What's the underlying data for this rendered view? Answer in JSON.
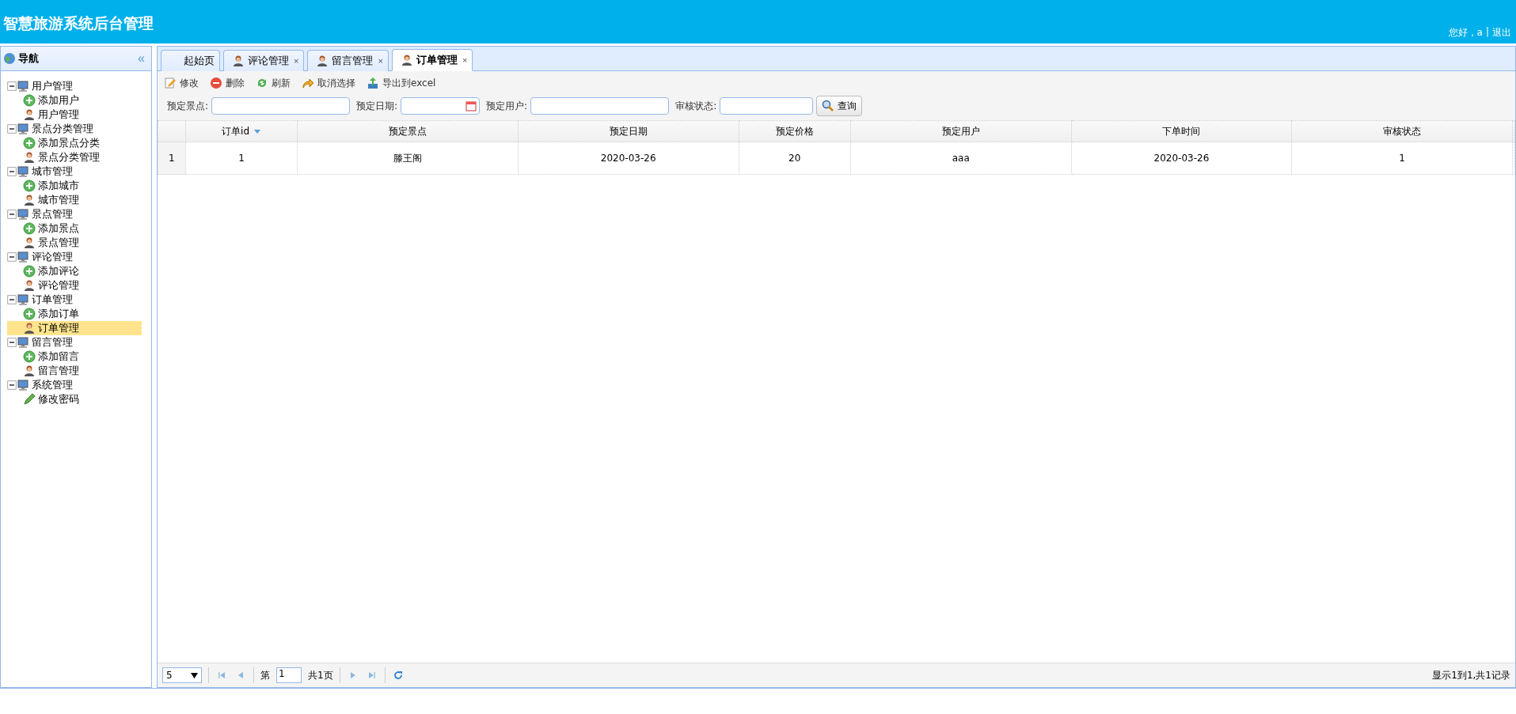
{
  "header": {
    "title": "智慧旅游系统后台管理",
    "greeting": "您好，a",
    "separator": "|",
    "logout": "退出"
  },
  "sidebar": {
    "title": "导航",
    "collapse": "«",
    "tree": [
      {
        "label": "用户管理",
        "children": [
          {
            "label": "添加用户",
            "kind": "add",
            "selected": false
          },
          {
            "label": "用户管理",
            "kind": "user",
            "selected": false
          }
        ]
      },
      {
        "label": "景点分类管理",
        "children": [
          {
            "label": "添加景点分类",
            "kind": "add",
            "selected": false
          },
          {
            "label": "景点分类管理",
            "kind": "user",
            "selected": false
          }
        ]
      },
      {
        "label": "城市管理",
        "children": [
          {
            "label": "添加城市",
            "kind": "add",
            "selected": false
          },
          {
            "label": "城市管理",
            "kind": "user",
            "selected": false
          }
        ]
      },
      {
        "label": "景点管理",
        "children": [
          {
            "label": "添加景点",
            "kind": "add",
            "selected": false
          },
          {
            "label": "景点管理",
            "kind": "user",
            "selected": false
          }
        ]
      },
      {
        "label": "评论管理",
        "children": [
          {
            "label": "添加评论",
            "kind": "add",
            "selected": false
          },
          {
            "label": "评论管理",
            "kind": "user",
            "selected": false
          }
        ]
      },
      {
        "label": "订单管理",
        "children": [
          {
            "label": "添加订单",
            "kind": "add",
            "selected": false
          },
          {
            "label": "订单管理",
            "kind": "user",
            "selected": true
          }
        ]
      },
      {
        "label": "留言管理",
        "children": [
          {
            "label": "添加留言",
            "kind": "add",
            "selected": false
          },
          {
            "label": "留言管理",
            "kind": "user",
            "selected": false
          }
        ]
      },
      {
        "label": "系统管理",
        "children": [
          {
            "label": "修改密码",
            "kind": "edit",
            "selected": false
          }
        ]
      }
    ]
  },
  "tabs": [
    {
      "label": "起始页",
      "kind": "plain",
      "selected": false
    },
    {
      "label": "评论管理",
      "kind": "user",
      "close": "×",
      "selected": false
    },
    {
      "label": "留言管理",
      "kind": "user",
      "close": "×",
      "selected": false
    },
    {
      "label": "订单管理",
      "kind": "user",
      "close": "×",
      "selected": true
    }
  ],
  "toolbar": [
    {
      "label": "修改",
      "kind": "edit"
    },
    {
      "label": "删除",
      "kind": "delete"
    },
    {
      "label": "刷新",
      "kind": "refresh"
    },
    {
      "label": "取消选择",
      "kind": "undo"
    },
    {
      "label": "导出到excel",
      "kind": "export"
    }
  ],
  "filters": [
    {
      "label": "预定景点:",
      "kind": "text"
    },
    {
      "label": "预定日期:",
      "kind": "date"
    },
    {
      "label": "预定用户:",
      "kind": "text"
    },
    {
      "label": "审核状态:",
      "kind": "text"
    }
  ],
  "query_button": "查询",
  "table": {
    "columns": [
      {
        "label": "订单id",
        "sorted": true
      },
      {
        "label": "预定景点",
        "sorted": false
      },
      {
        "label": "预定日期",
        "sorted": false
      },
      {
        "label": "预定价格",
        "sorted": false
      },
      {
        "label": "预定用户",
        "sorted": false
      },
      {
        "label": "下单时间",
        "sorted": false
      },
      {
        "label": "审核状态",
        "sorted": false
      }
    ],
    "rows": [
      {
        "number": "1",
        "cells": [
          "1",
          "滕王阁",
          "2020-03-26",
          "20",
          "aaa",
          "2020-03-26",
          "1"
        ]
      }
    ]
  },
  "pager": {
    "page_size": "5",
    "page_prefix": "第",
    "page": "1",
    "total_pages": "共1页",
    "summary": "显示1到1,共1记录"
  }
}
